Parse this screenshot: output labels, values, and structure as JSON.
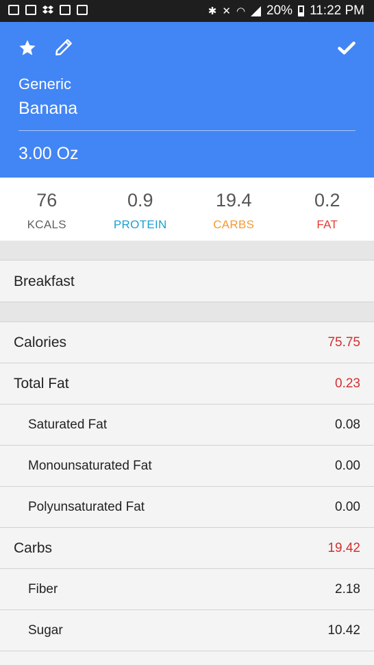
{
  "status_bar": {
    "time": "11:22 PM",
    "battery": "20%",
    "icons_left": [
      "gallery-icon",
      "email-icon",
      "dropbox-icon",
      "phone-icon",
      "voicemail-icon"
    ],
    "icons_right": [
      "bluetooth-icon",
      "mute-icon",
      "wifi-icon",
      "signal-icon",
      "battery-icon"
    ]
  },
  "header": {
    "brand": "Generic",
    "food": "Banana",
    "serving": "3.00 Oz",
    "color": "#4285f4"
  },
  "macros": [
    {
      "value": "76",
      "label": "KCALS",
      "color": "#616161"
    },
    {
      "value": "0.9",
      "label": "PROTEIN",
      "color": "#1a9fd4"
    },
    {
      "value": "19.4",
      "label": "CARBS",
      "color": "#f59a32"
    },
    {
      "value": "0.2",
      "label": "FAT",
      "color": "#e53935"
    }
  ],
  "meal": "Breakfast",
  "nutrients": [
    {
      "label": "Calories",
      "value": "75.75",
      "highlight": true,
      "sub": false
    },
    {
      "label": "Total Fat",
      "value": "0.23",
      "highlight": true,
      "sub": false
    },
    {
      "label": "Saturated Fat",
      "value": "0.08",
      "highlight": false,
      "sub": true
    },
    {
      "label": "Monounsaturated Fat",
      "value": "0.00",
      "highlight": false,
      "sub": true
    },
    {
      "label": "Polyunsaturated Fat",
      "value": "0.00",
      "highlight": false,
      "sub": true
    },
    {
      "label": "Carbs",
      "value": "19.42",
      "highlight": true,
      "sub": false
    },
    {
      "label": "Fiber",
      "value": "2.18",
      "highlight": false,
      "sub": true
    },
    {
      "label": "Sugar",
      "value": "10.42",
      "highlight": false,
      "sub": true
    }
  ]
}
